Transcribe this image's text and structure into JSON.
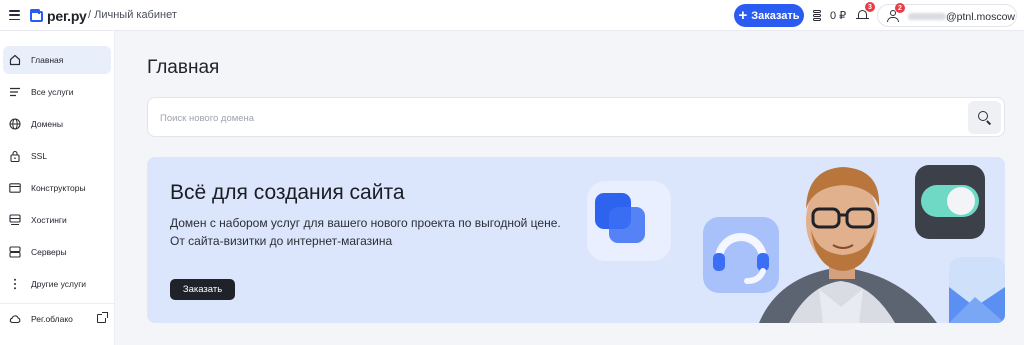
{
  "header": {
    "logo_text": "рег.ру",
    "breadcrumb": "/ Личный кабинет",
    "order_button": "Заказать",
    "balance": "0 ₽",
    "notifications_count": "3",
    "user_badge_count": "2",
    "email_suffix": "@ptnl.moscow"
  },
  "sidebar": {
    "items": [
      {
        "label": "Главная",
        "icon": "home-icon",
        "active": true
      },
      {
        "label": "Все услуги",
        "icon": "list-icon"
      },
      {
        "label": "Домены",
        "icon": "globe-icon"
      },
      {
        "label": "SSL",
        "icon": "lock-icon"
      },
      {
        "label": "Конструкторы",
        "icon": "window-icon"
      },
      {
        "label": "Хостинги",
        "icon": "hosting-icon"
      },
      {
        "label": "Серверы",
        "icon": "server-icon"
      },
      {
        "label": "Другие услуги",
        "icon": "more-vertical-icon"
      }
    ],
    "cloud_label": "Рег.облако"
  },
  "main": {
    "title": "Главная",
    "search_placeholder": "Поиск нового домена",
    "banner": {
      "title": "Всё для создания сайта",
      "description_line1": "Домен с набором услуг для вашего нового проекта по выгодной цене.",
      "description_line2": "От сайта-визитки до интернет-магазина",
      "button": "Заказать"
    }
  },
  "colors": {
    "accent": "#2b5cf2",
    "badge": "#ea3b46",
    "banner_bg": "#dbe5fc",
    "page_bg": "#f4f5f8"
  }
}
